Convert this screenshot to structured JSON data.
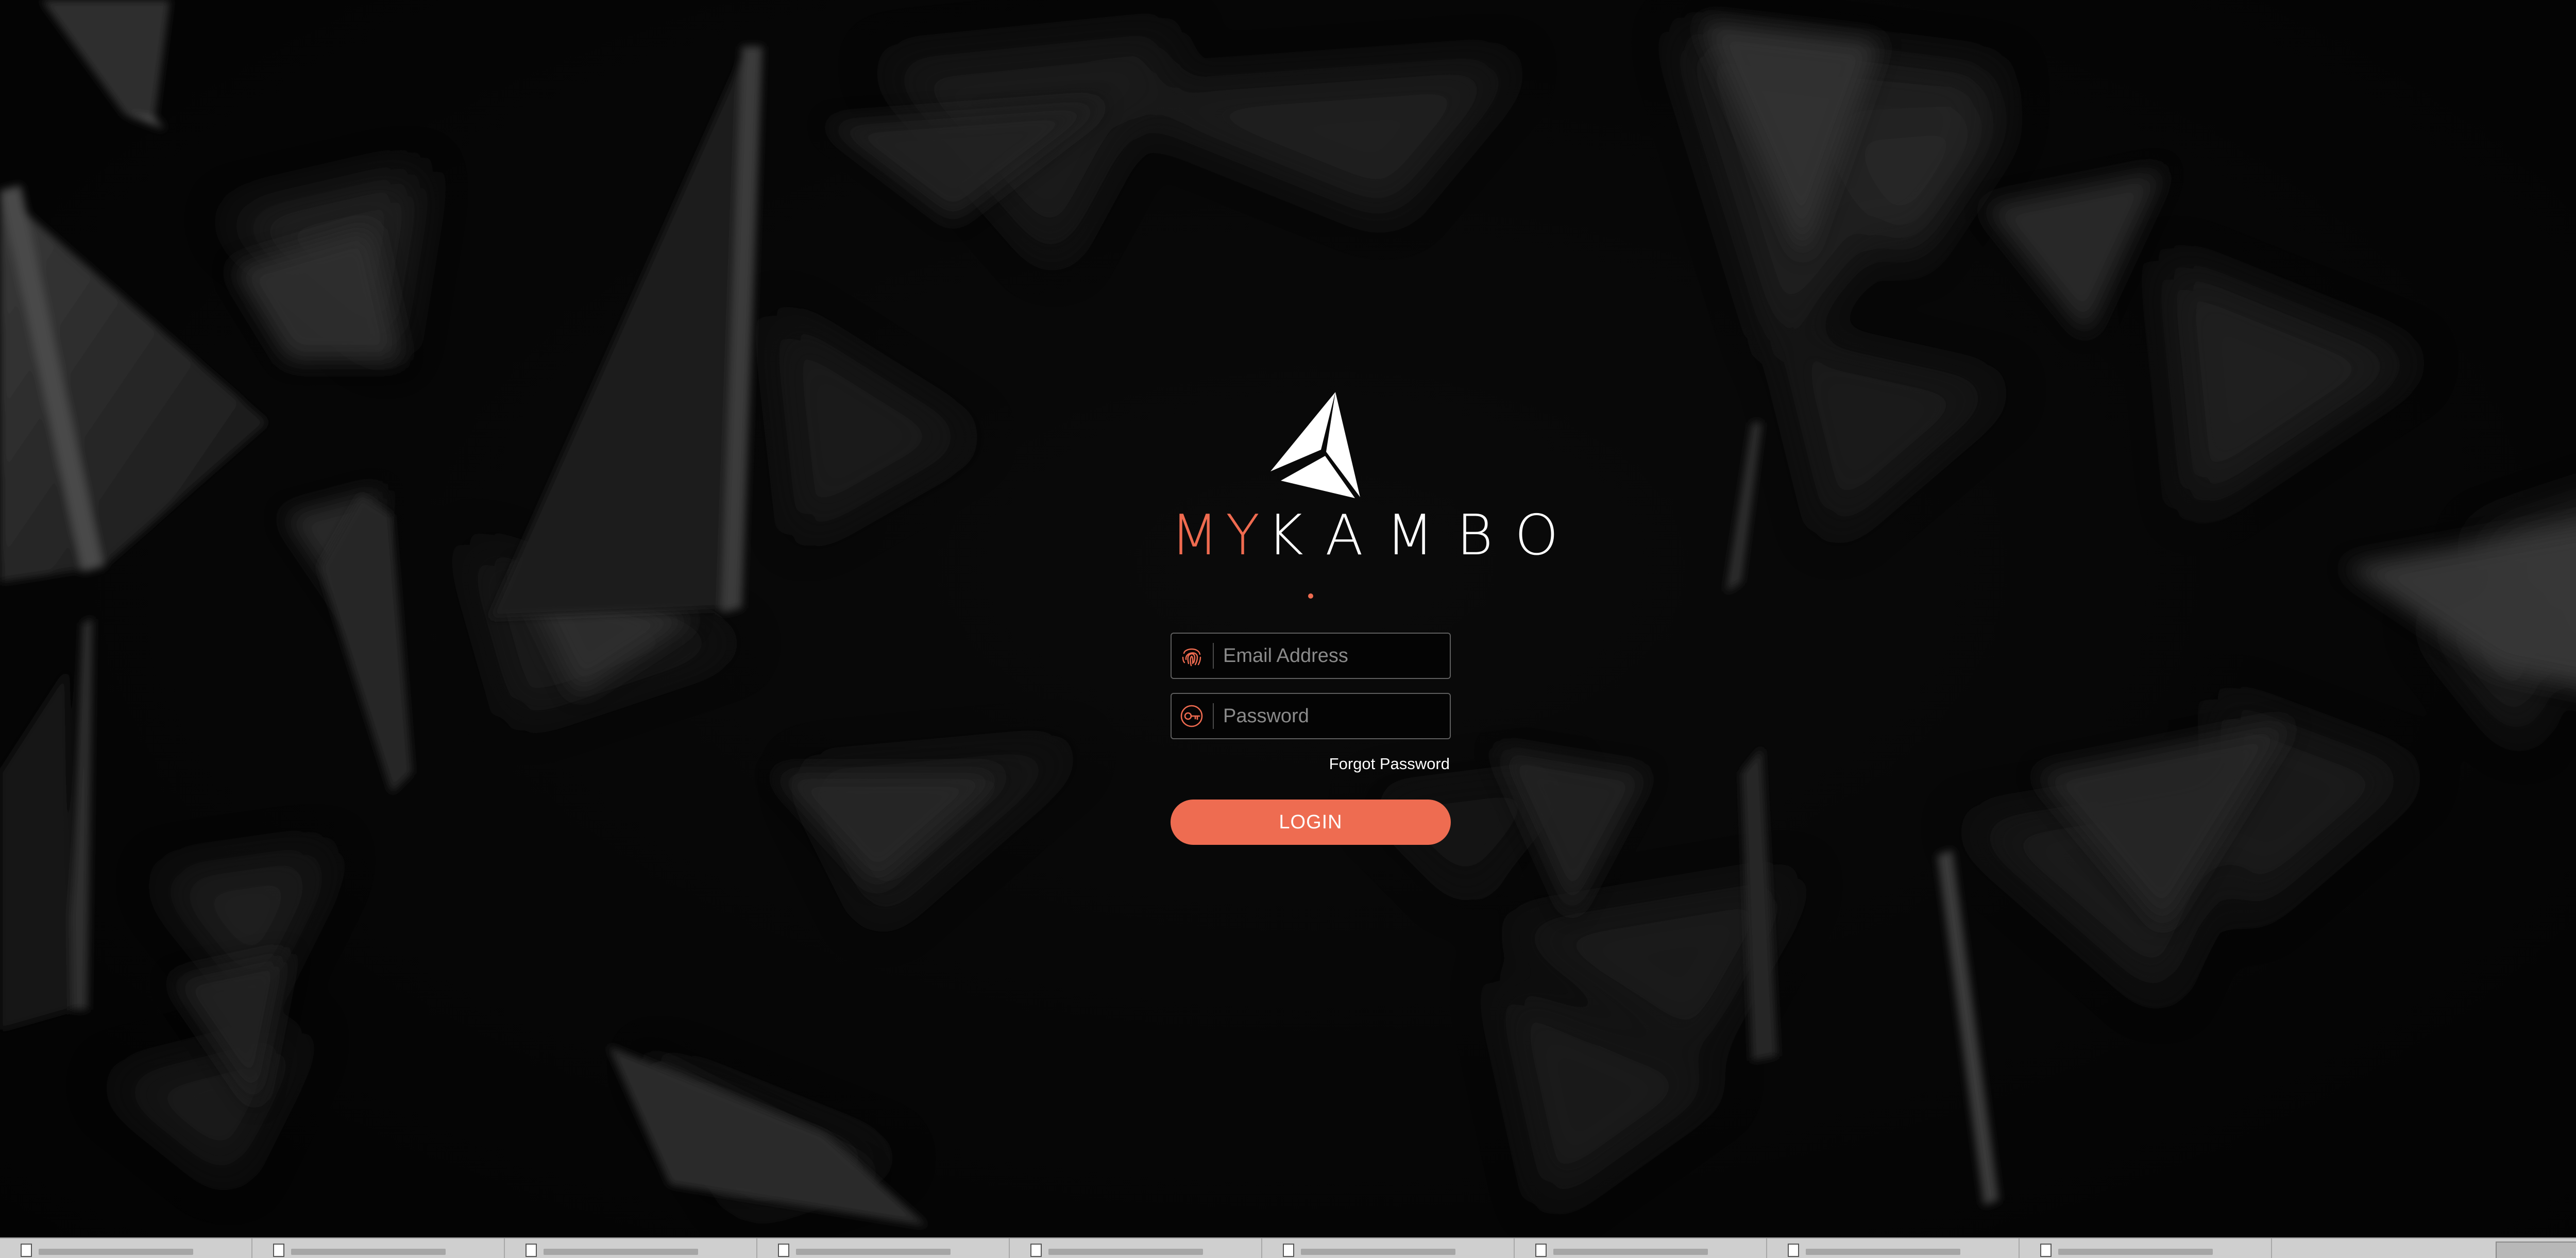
{
  "brand": {
    "name_accent": "MY",
    "name_rest": "KAMBO",
    "accent_color": "#ef6b50"
  },
  "login": {
    "email_placeholder": "Email Address",
    "email_icon": "fingerprint-icon",
    "password_placeholder": "Password",
    "password_icon": "key-icon",
    "forgot_label": "Forgot Password",
    "submit_label": "LOGIN",
    "button_color": "#ee6c51"
  },
  "taskbar": {
    "item_icon": "document-icon",
    "item_count": 9
  }
}
